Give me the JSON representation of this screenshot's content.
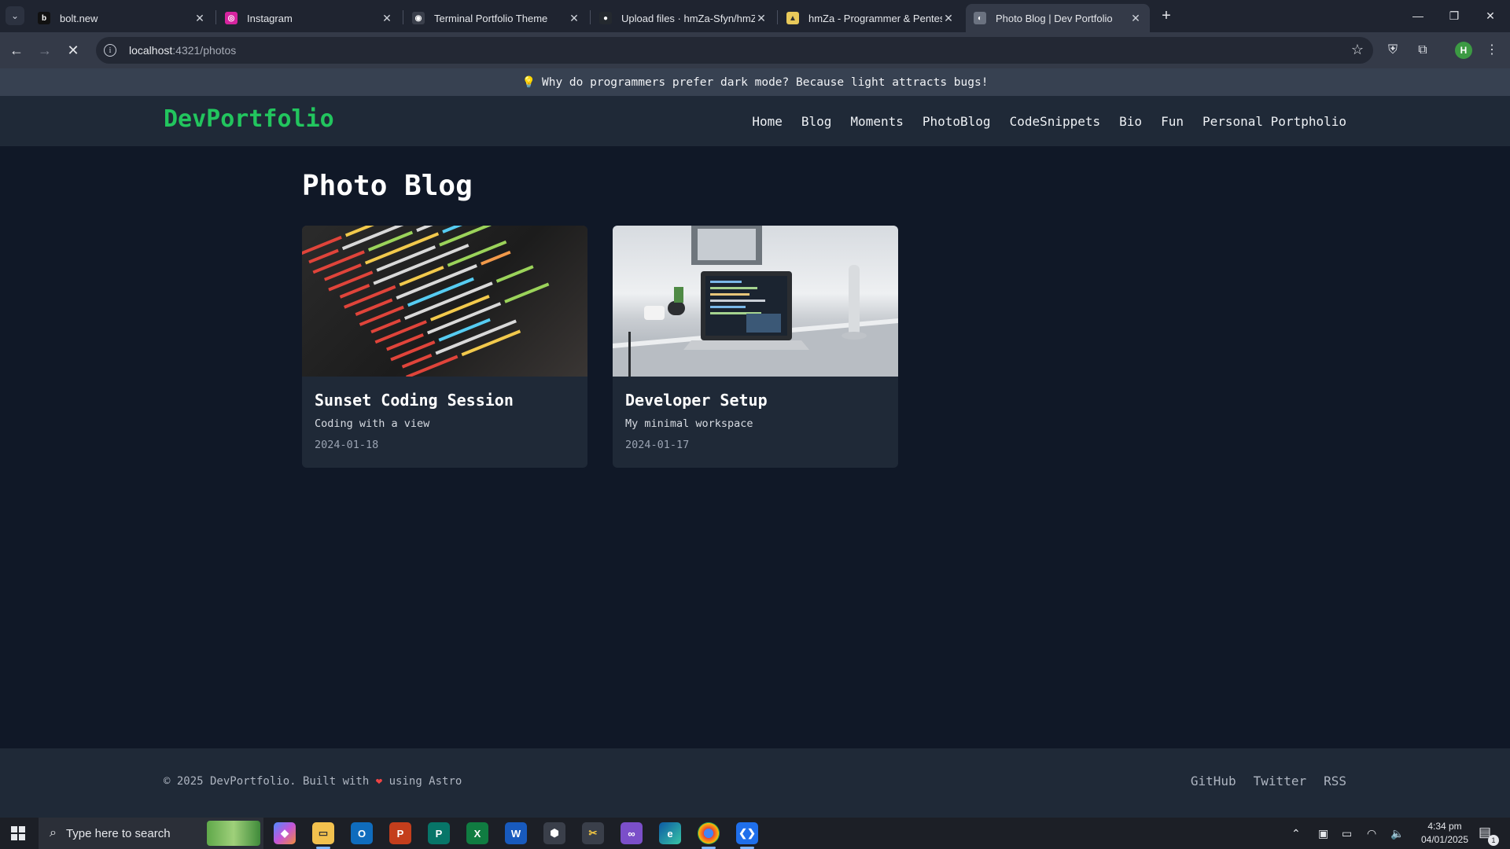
{
  "browser": {
    "tabs": [
      {
        "title": "bolt.new",
        "fav_color": "#111111",
        "fav_glyph": "b"
      },
      {
        "title": "Instagram",
        "fav_color": "#d6249f",
        "fav_glyph": "◎"
      },
      {
        "title": "Terminal Portfolio Theme",
        "fav_color": "#3a3f4b",
        "fav_glyph": "◉"
      },
      {
        "title": "Upload files · hmZa-Sfyn/hmZa",
        "fav_color": "#24292f",
        "fav_glyph": "●"
      },
      {
        "title": "hmZa - Programmer & Pentester",
        "fav_color": "#e8c95a",
        "fav_glyph": "▲"
      },
      {
        "title": "Photo Blog | Dev Portfolio",
        "fav_color": "#6b7280",
        "fav_glyph": "◐"
      }
    ],
    "tab_close": "✕",
    "new_tab": "+",
    "url_host": "localhost",
    "url_path": ":4321/photos",
    "profile_initial": "H"
  },
  "site": {
    "announcement": "Why do programmers prefer dark mode? Because light attracts bugs!",
    "bulb_icon": "💡",
    "logo": "DevPortfolio",
    "nav": [
      "Home",
      "Blog",
      "Moments",
      "PhotoBlog",
      "CodeSnippets",
      "Bio",
      "Fun",
      "Personal Portpholio"
    ],
    "page_title": "Photo Blog",
    "posts": [
      {
        "title": "Sunset Coding Session",
        "description": "Coding with a view",
        "date": "2024-01-18",
        "image_icon": "code-screen-photo"
      },
      {
        "title": "Developer Setup",
        "description": "My minimal workspace",
        "date": "2024-01-17",
        "image_icon": "laptop-desk-photo"
      }
    ],
    "footer": {
      "copyright_pre": "© 2025 DevPortfolio. Built with",
      "copyright_post": "using Astro",
      "links": [
        "GitHub",
        "Twitter",
        "RSS"
      ]
    }
  },
  "taskbar": {
    "search_placeholder": "Type here to search",
    "time": "4:34 pm",
    "date": "04/01/2025",
    "notification_count": "1",
    "apps": [
      "copilot",
      "file-explorer",
      "outlook",
      "powerpoint",
      "publisher",
      "excel",
      "word",
      "app-unknown",
      "snipping-tool",
      "visual-studio",
      "edge",
      "chrome",
      "vscode"
    ]
  },
  "colors": {
    "accent_green": "#22c55e",
    "page_bg": "#101827",
    "surface": "#1f2937"
  }
}
